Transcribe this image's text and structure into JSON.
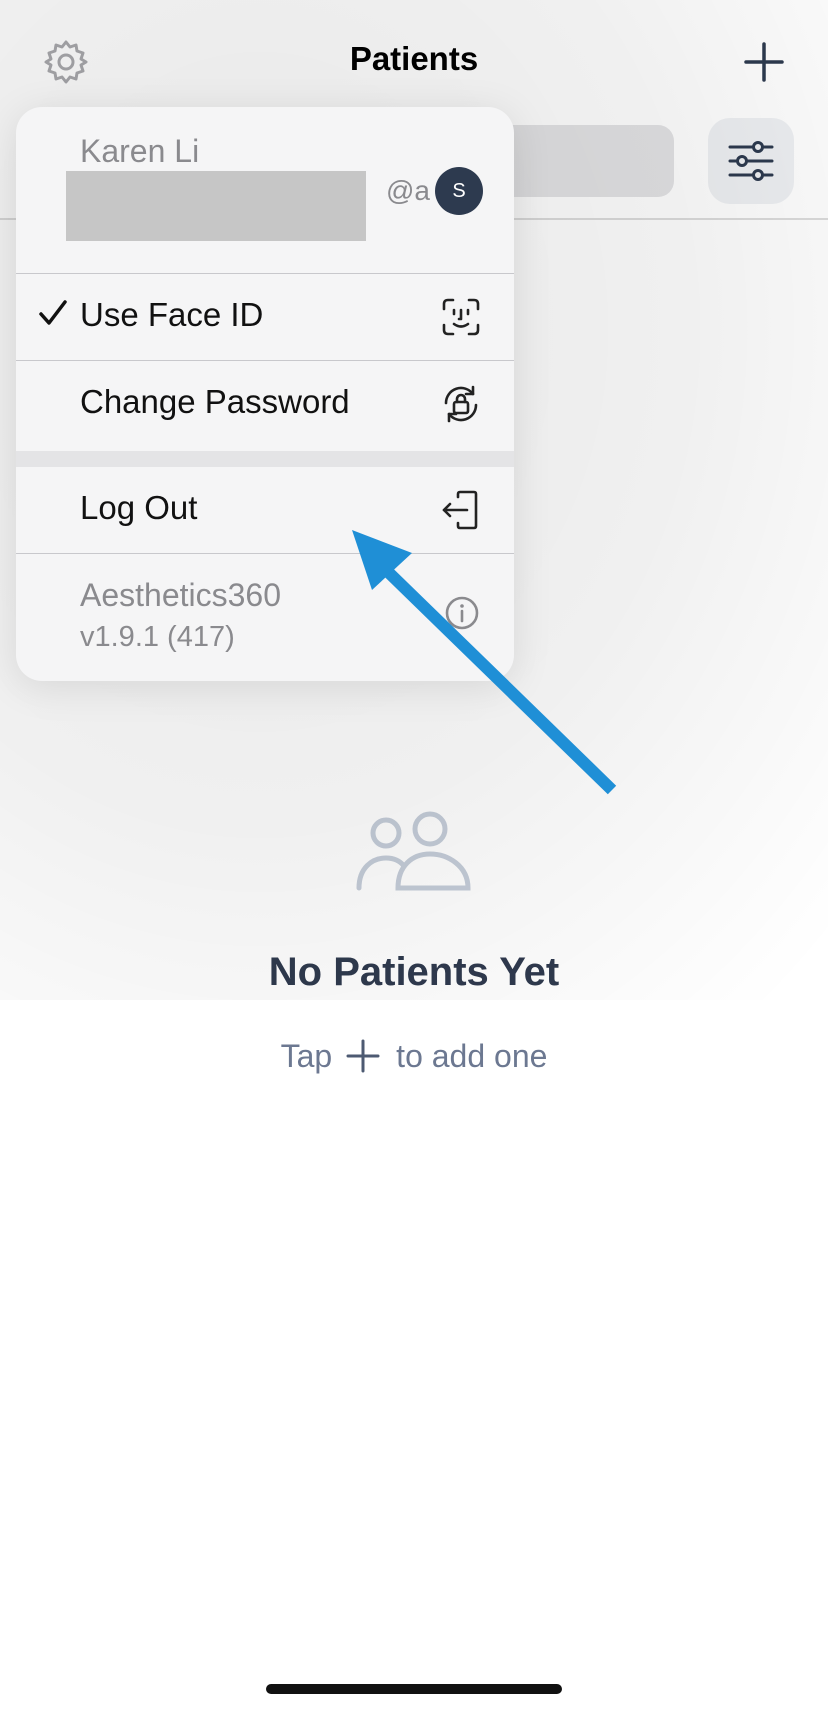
{
  "nav": {
    "title": "Patients",
    "settings_icon": "gear-icon",
    "add_icon": "plus-icon",
    "filter_icon": "sliders-icon"
  },
  "empty_state": {
    "icon": "people-icon",
    "title": "No Patients Yet",
    "hint_before": "Tap",
    "hint_after": "to add one"
  },
  "menu": {
    "user": {
      "name": "Karen Li",
      "email_visible_suffix": "@a",
      "avatar_initial": "S"
    },
    "items": [
      {
        "label": "Use Face ID",
        "checked": true,
        "icon": "face-id-icon"
      },
      {
        "label": "Change Password",
        "checked": false,
        "icon": "lock-rotate-icon"
      },
      {
        "label": "Log Out",
        "checked": false,
        "icon": "log-out-icon"
      }
    ],
    "footer": {
      "app_name": "Aesthetics360",
      "version": "v1.9.1 (417)",
      "icon": "info-icon"
    }
  },
  "colors": {
    "avatar_bg": "#2d3a4f",
    "title_text": "#2f3a4e",
    "hint_text": "#6c7891",
    "empty_icon": "#c5cdd9",
    "annotation_arrow": "#1f8fd6"
  }
}
